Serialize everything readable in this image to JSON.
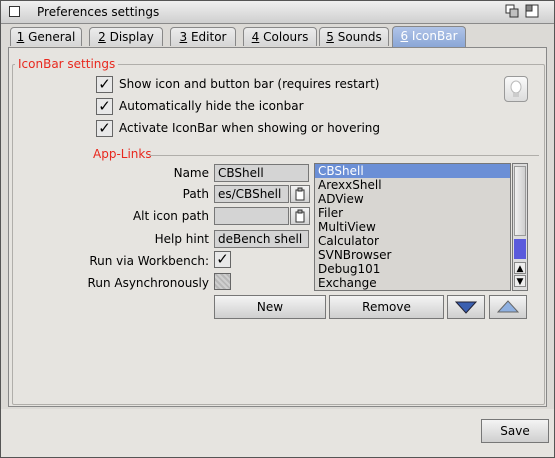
{
  "window": {
    "title": "Preferences settings"
  },
  "tabs": [
    {
      "num": "1",
      "label": "General",
      "active": false
    },
    {
      "num": "2",
      "label": "Display",
      "active": false
    },
    {
      "num": "3",
      "label": "Editor",
      "active": false
    },
    {
      "num": "4",
      "label": "Colours",
      "active": false
    },
    {
      "num": "5",
      "label": "Sounds",
      "active": false
    },
    {
      "num": "6",
      "label": "IconBar",
      "active": true
    }
  ],
  "group": {
    "title": "IconBar settings",
    "checks": [
      {
        "label": "Show icon and button bar (requires restart)",
        "checked": true
      },
      {
        "label": "Automatically hide the iconbar",
        "checked": true
      },
      {
        "label": "Activate IconBar when showing or hovering",
        "checked": true
      }
    ]
  },
  "applinks": {
    "title": "App-Links",
    "name_label": "Name",
    "name_value": "CBShell",
    "path_label": "Path",
    "path_value": "es/CBShell",
    "alticon_label": "Alt icon path",
    "alticon_value": "",
    "hint_label": "Help hint",
    "hint_value": "deBench shell",
    "wb_label": "Run via Workbench:",
    "wb_checked": true,
    "async_label": "Run Asynchronously",
    "async_checked": false,
    "list": [
      "CBShell",
      "ArexxShell",
      "ADView",
      "Filer",
      "MultiView",
      "Calculator",
      "SVNBrowser",
      "Debug101",
      "Exchange"
    ],
    "selected": "CBShell",
    "new_label": "New",
    "remove_label": "Remove"
  },
  "footer": {
    "save_label": "Save"
  }
}
